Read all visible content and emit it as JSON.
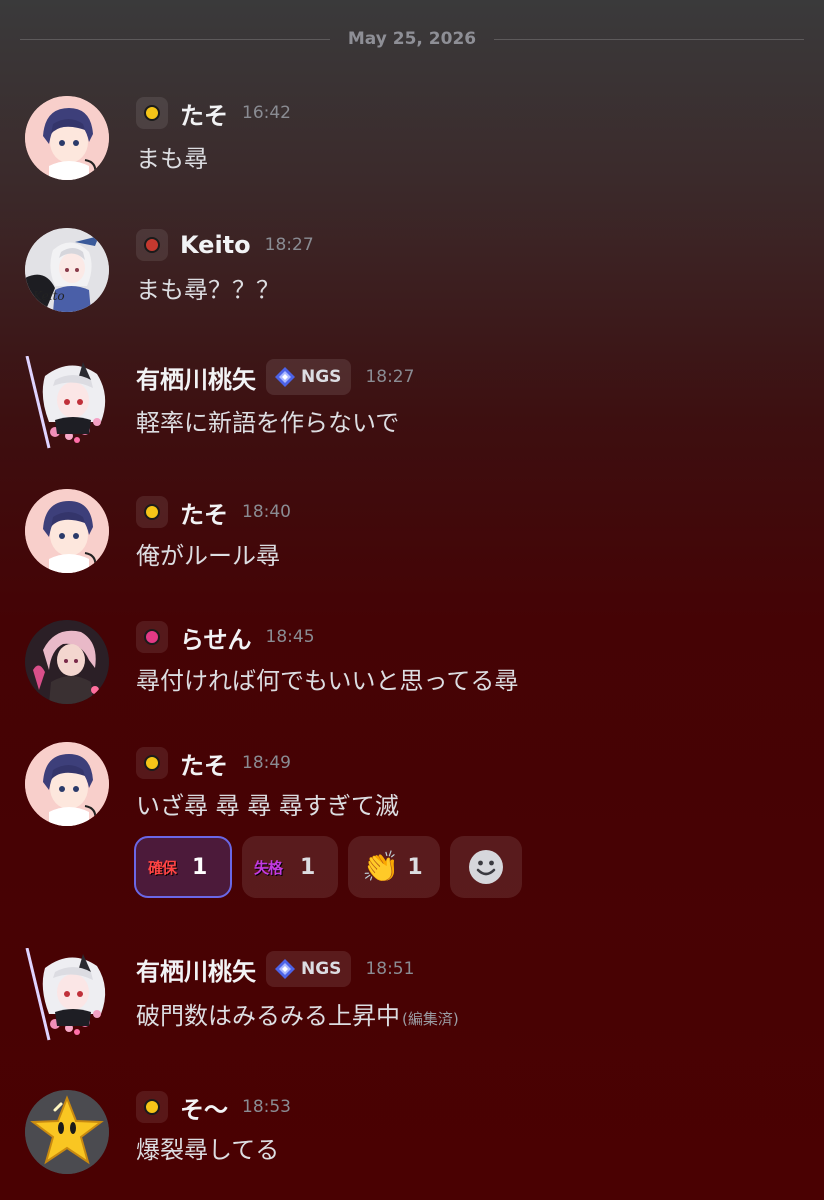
{
  "date_divider": "May 25, 2026",
  "colors": {
    "yellow_badge": "#f5c518",
    "red_badge": "#c4392f",
    "pink_badge": "#e23a86",
    "accent": "#6a67e6"
  },
  "messages": [
    {
      "username": "たそ",
      "badge": "yellow-dot",
      "time": "16:42",
      "text": "まも尋"
    },
    {
      "username": "Keito",
      "badge": "red-dot",
      "time": "18:27",
      "text": "まも尋？？？"
    },
    {
      "username": "有栖川桃矢",
      "tag_icon": "diamond-icon",
      "tag": "NGS",
      "time": "18:27",
      "text": "軽率に新語を作らないで"
    },
    {
      "username": "たそ",
      "badge": "yellow-dot",
      "time": "18:40",
      "text": "俺がルール尋"
    },
    {
      "username": "らせん",
      "badge": "pink-dot",
      "time": "18:45",
      "text": "尋付ければ何でもいいと思ってる尋"
    },
    {
      "username": "たそ",
      "badge": "yellow-dot",
      "time": "18:49",
      "text": "いざ尋 尋 尋 尋すぎて滅"
    },
    {
      "username": "有栖川桃矢",
      "tag_icon": "diamond-icon",
      "tag": "NGS",
      "time": "18:51",
      "text": "破門数はみるみる上昇中",
      "edited": "(編集済)"
    },
    {
      "username": "そ〜",
      "badge": "yellow-dot",
      "time": "18:53",
      "text": "爆裂尋してる"
    }
  ],
  "reactions": [
    {
      "emoji_text": "確保",
      "count": "1",
      "active": true
    },
    {
      "emoji_text": "失格",
      "count": "1",
      "active": false
    },
    {
      "emoji": "👏",
      "emoji_name": "clapping-hands-icon",
      "count": "1",
      "active": false
    },
    {
      "emoji_name": "add-reaction-icon"
    }
  ]
}
